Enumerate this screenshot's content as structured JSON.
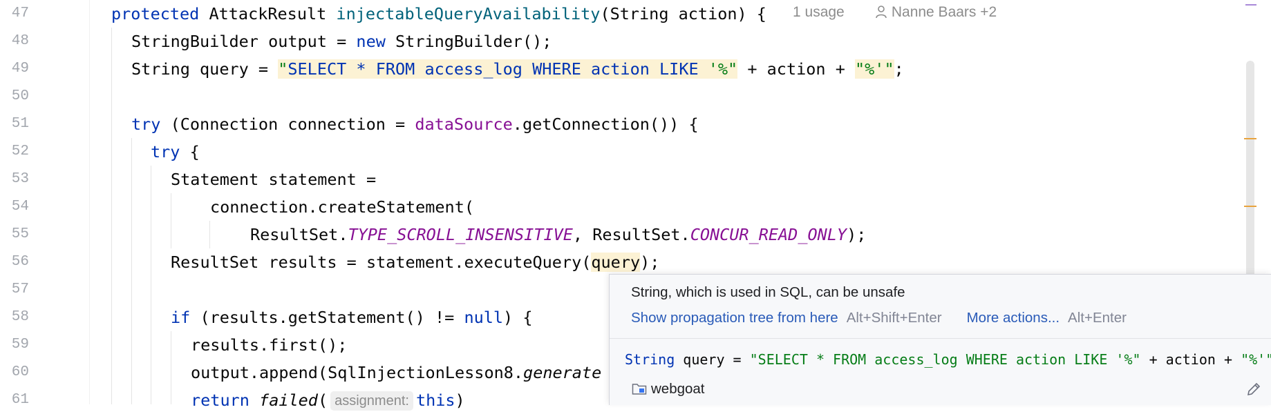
{
  "editor": {
    "lines": [
      {
        "num": "47"
      },
      {
        "num": "48"
      },
      {
        "num": "49"
      },
      {
        "num": "50"
      },
      {
        "num": "51"
      },
      {
        "num": "52"
      },
      {
        "num": "53"
      },
      {
        "num": "54"
      },
      {
        "num": "55"
      },
      {
        "num": "56"
      },
      {
        "num": "57"
      },
      {
        "num": "58"
      },
      {
        "num": "59"
      },
      {
        "num": "60"
      },
      {
        "num": "61"
      }
    ],
    "tok": {
      "protected": "protected",
      "attack_result": " AttackResult ",
      "method_name": "injectableQueryAvailability",
      "params": "(String action) {",
      "sb_decl": "StringBuilder output = ",
      "new_kw": "new",
      "sb_ctor": " StringBuilder();",
      "query_decl": "String query = ",
      "q_open": "\"",
      "q_sql": "SELECT * FROM access_log WHERE action LIKE ",
      "q_pct": "'%\"",
      "q_plus_action": " + action + ",
      "q_close": "\"%'\"",
      "semicolon": ";",
      "try_kw": "try",
      "conn_open": " (Connection connection = ",
      "datasource": "dataSource",
      "get_conn": ".getConnection()) {",
      "try_brace": " {",
      "stmt_decl": "Statement statement =",
      "create_stmt": "connection.createStatement(",
      "rs_prefix": "ResultSet.",
      "type_scroll": "TYPE_SCROLL_INSENSITIVE",
      "comma_rs": ", ResultSet.",
      "concur": "CONCUR_READ_ONLY",
      "close_paren": ");",
      "results_decl": "ResultSet results = statement.executeQuery(",
      "query_ref": "query",
      "if_kw": "if",
      "if_cond": " (results.getStatement() != ",
      "null_kw": "null",
      "if_close": ") {",
      "first_call": "results.first();",
      "append_call": "output.append(SqlInjectionLesson8.",
      "generate": "generate",
      "return_kw": "return",
      "failed": "failed",
      "open_paren": "(",
      "assign_hint": "assignment:",
      "this_kw": "this",
      "paren_close": ")"
    },
    "hints": {
      "usages": "1 usage",
      "authors": "Nanne Baars +2"
    }
  },
  "popup": {
    "message": "String, which is used in SQL, can be unsafe",
    "action1": "Show propagation tree from here",
    "action1_shortcut": "Alt+Shift+Enter",
    "action2": "More actions...",
    "action2_shortcut": "Alt+Enter",
    "code": {
      "type": "String",
      "rest": " query = ",
      "str1": "\"SELECT * FROM access_log WHERE action LIKE '%\"",
      "mid": " + action + ",
      "str2": "\"%'\""
    },
    "module": "webgoat"
  },
  "colors": {
    "keyword": "#0033b3",
    "method": "#00627a",
    "string": "#067d17",
    "field": "#871094",
    "highlight": "#fcf2d4",
    "link": "#2a5bb8"
  }
}
